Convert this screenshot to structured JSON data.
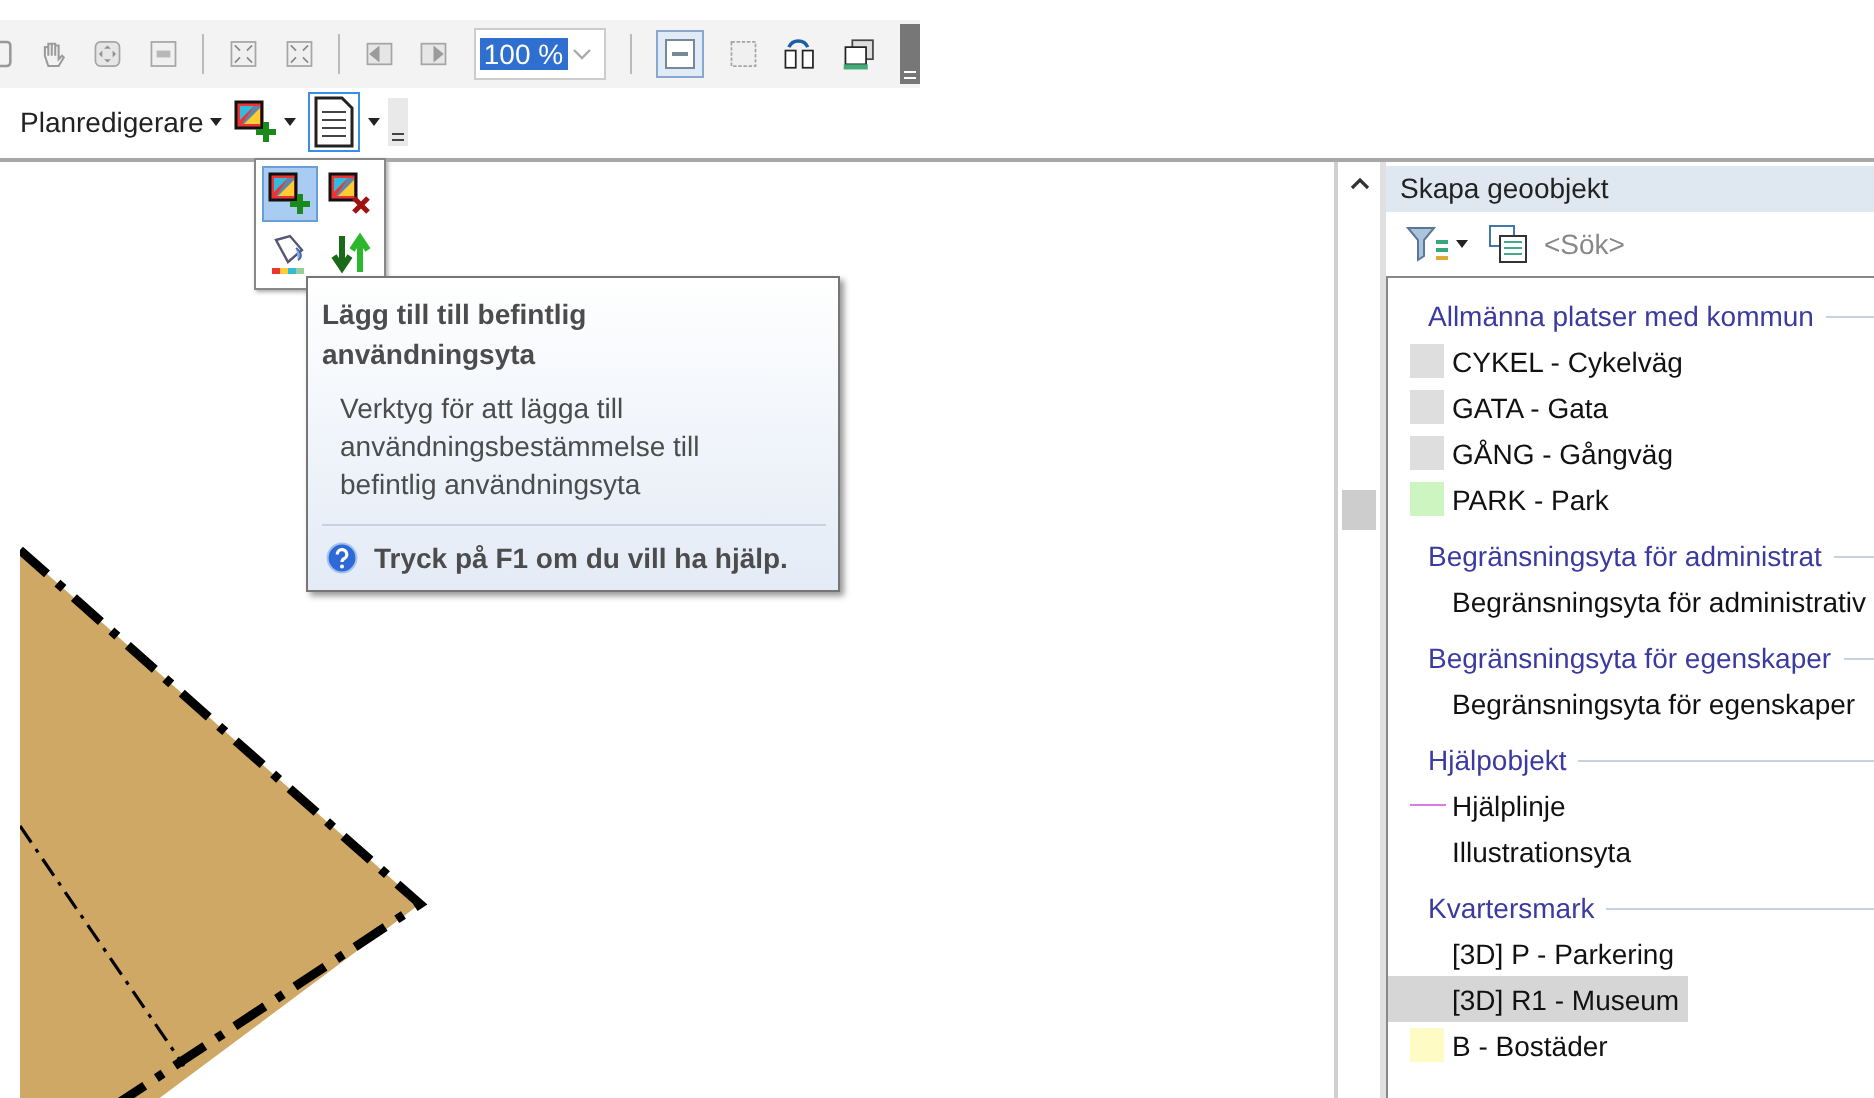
{
  "toolbar": {
    "zoom_value": "100 %",
    "menu_label": "Planredigerare"
  },
  "tool_menu": {
    "items": [
      {
        "kind": "add-area",
        "selected": true
      },
      {
        "kind": "remove-area",
        "selected": false
      },
      {
        "kind": "paint",
        "selected": false
      },
      {
        "kind": "swap",
        "selected": false
      }
    ]
  },
  "tooltip": {
    "title": "Lägg till till befintlig användningsyta",
    "description": "Verktyg för att lägga till användningsbestämmelse till befintlig användningsyta",
    "help": "Tryck på F1 om du vill ha hjälp."
  },
  "panel": {
    "title": "Skapa geoobjekt",
    "search": {
      "placeholder": "<Sök>"
    },
    "groups": [
      {
        "heading": "Allmänna platser med kommun",
        "items": [
          {
            "label": "CYKEL - Cykelväg",
            "kind": "swatch",
            "color": "#dedede",
            "selected": false
          },
          {
            "label": "GATA - Gata",
            "kind": "swatch",
            "color": "#dedede",
            "selected": false
          },
          {
            "label": "GÅNG - Gångväg",
            "kind": "swatch",
            "color": "#dedede",
            "selected": false
          },
          {
            "label": "PARK - Park",
            "kind": "swatch",
            "color": "#ccf5c0",
            "selected": false
          }
        ]
      },
      {
        "heading": "Begränsningsyta för administrat",
        "items": [
          {
            "label": "Begränsningsyta för administrativ",
            "kind": "plain",
            "selected": false
          }
        ]
      },
      {
        "heading": "Begränsningsyta för egenskaper",
        "items": [
          {
            "label": "Begränsningsyta för egenskaper",
            "kind": "plain",
            "selected": false
          }
        ]
      },
      {
        "heading": "Hjälpobjekt",
        "items": [
          {
            "label": "Hjälplinje",
            "kind": "line",
            "color": "#d77ee0",
            "selected": false
          },
          {
            "label": "Illustrationsyta",
            "kind": "plain",
            "selected": false
          }
        ]
      },
      {
        "heading": "Kvartersmark",
        "items": [
          {
            "label": "[3D] P - Parkering",
            "kind": "plain",
            "selected": false
          },
          {
            "label": "[3D] R1 - Museum",
            "kind": "plain",
            "selected": true
          },
          {
            "label": "B - Bostäder",
            "kind": "swatch",
            "color": "#fffbc4",
            "selected": false
          }
        ]
      }
    ]
  }
}
